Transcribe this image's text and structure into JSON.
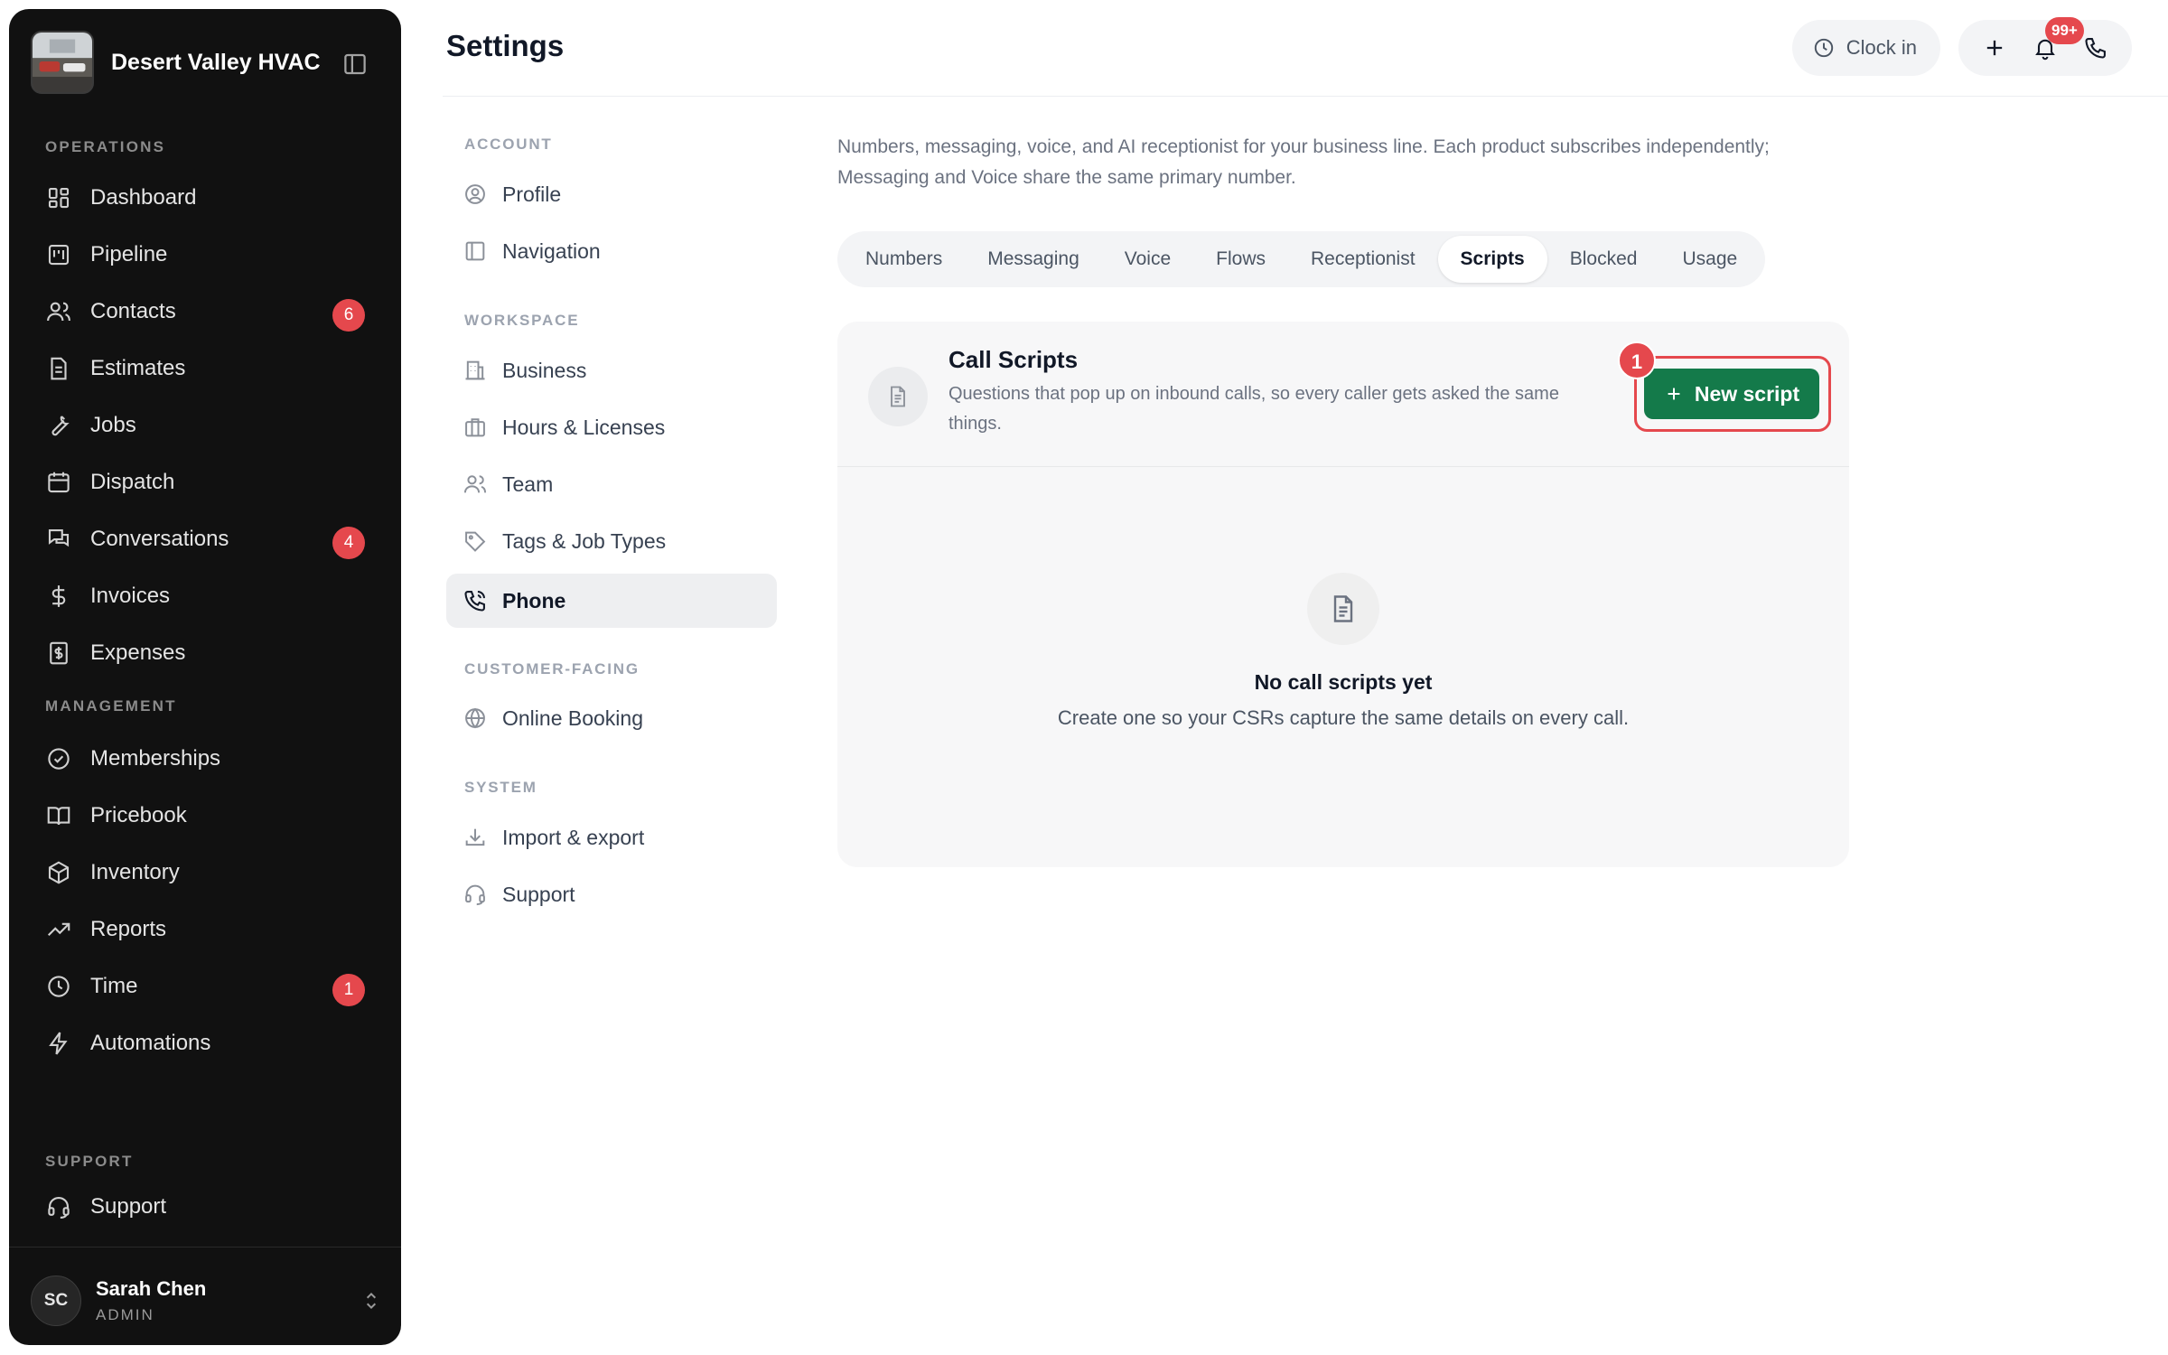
{
  "brand": {
    "name": "Desert Valley HVAC"
  },
  "sidebar": {
    "sections": {
      "operations": "OPERATIONS",
      "management": "MANAGEMENT",
      "support": "SUPPORT"
    },
    "operations": [
      {
        "label": "Dashboard",
        "icon": "dashboard-icon"
      },
      {
        "label": "Pipeline",
        "icon": "pipeline-icon"
      },
      {
        "label": "Contacts",
        "icon": "users-icon",
        "badge": "6"
      },
      {
        "label": "Estimates",
        "icon": "document-icon"
      },
      {
        "label": "Jobs",
        "icon": "wrench-icon"
      },
      {
        "label": "Dispatch",
        "icon": "calendar-icon"
      },
      {
        "label": "Conversations",
        "icon": "chat-icon",
        "badge": "4"
      },
      {
        "label": "Invoices",
        "icon": "dollar-icon"
      },
      {
        "label": "Expenses",
        "icon": "receipt-icon"
      }
    ],
    "management": [
      {
        "label": "Memberships",
        "icon": "badge-check-icon"
      },
      {
        "label": "Pricebook",
        "icon": "book-icon"
      },
      {
        "label": "Inventory",
        "icon": "box-icon"
      },
      {
        "label": "Reports",
        "icon": "trend-icon"
      },
      {
        "label": "Time",
        "icon": "clock-icon",
        "badge": "1"
      },
      {
        "label": "Automations",
        "icon": "bolt-icon"
      }
    ],
    "support": [
      {
        "label": "Support",
        "icon": "headset-icon"
      }
    ],
    "user": {
      "initials": "SC",
      "name": "Sarah Chen",
      "role": "ADMIN"
    }
  },
  "header": {
    "title": "Settings",
    "clock_in": "Clock in",
    "notifications_badge": "99+"
  },
  "settings_nav": {
    "account_label": "ACCOUNT",
    "account": [
      {
        "label": "Profile"
      },
      {
        "label": "Navigation"
      }
    ],
    "workspace_label": "WORKSPACE",
    "workspace": [
      {
        "label": "Business"
      },
      {
        "label": "Hours & Licenses"
      },
      {
        "label": "Team"
      },
      {
        "label": "Tags & Job Types"
      },
      {
        "label": "Phone",
        "active": true
      }
    ],
    "customer_label": "CUSTOMER-FACING",
    "customer": [
      {
        "label": "Online Booking"
      }
    ],
    "system_label": "SYSTEM",
    "system": [
      {
        "label": "Import & export"
      },
      {
        "label": "Support"
      }
    ]
  },
  "main": {
    "intro": "Numbers, messaging, voice, and AI receptionist for your business line. Each product subscribes independently; Messaging and Voice share the same primary number.",
    "tabs": [
      {
        "label": "Numbers"
      },
      {
        "label": "Messaging"
      },
      {
        "label": "Voice"
      },
      {
        "label": "Flows"
      },
      {
        "label": "Receptionist"
      },
      {
        "label": "Scripts",
        "active": true
      },
      {
        "label": "Blocked"
      },
      {
        "label": "Usage"
      }
    ],
    "card": {
      "title": "Call Scripts",
      "description": "Questions that pop up on inbound calls, so every caller gets asked the same things.",
      "new_button": "New script",
      "step_marker": "1",
      "empty_title": "No call scripts yet",
      "empty_desc": "Create one so your CSRs capture the same details on every call."
    }
  },
  "colors": {
    "accent": "#147a4a",
    "badge": "#e5484d",
    "sidebar_bg": "#111111"
  }
}
